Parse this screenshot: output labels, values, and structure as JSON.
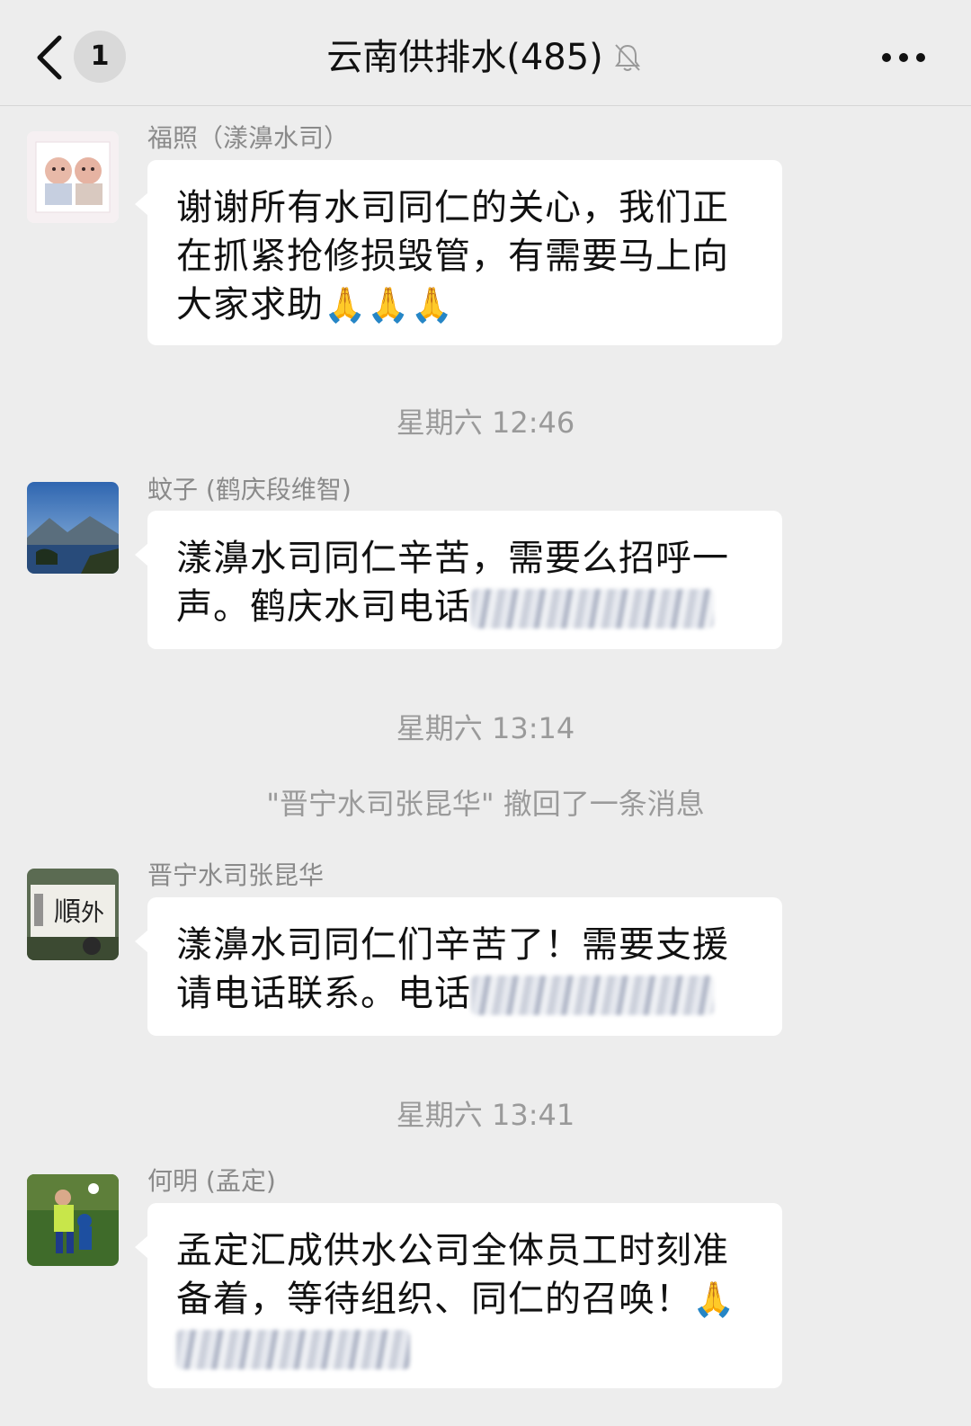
{
  "header": {
    "unread_count": "1",
    "title": "云南供排水(485)"
  },
  "messages": [
    {
      "sender": "福照（漾濞水司）",
      "text": "谢谢所有水司同仁的关心，我们正在抓紧抢修损毁管，有需要马上向大家求助",
      "emoji": "🙏🙏🙏"
    },
    {
      "timestamp": "星期六 12:46",
      "sender": "蚊子 (鹤庆段维智)",
      "text": "漾濞水司同仁辛苦，需要么招呼一声。鹤庆水司电话"
    },
    {
      "timestamp": "星期六 13:14",
      "system": "\"晋宁水司张昆华\" 撤回了一条消息",
      "sender": "晋宁水司张昆华",
      "text": "漾濞水司同仁们辛苦了！需要支援请电话联系。电话"
    },
    {
      "timestamp": "星期六 13:41",
      "sender": "何明 (孟定)",
      "text": "孟定汇成供水公司全体员工时刻准备着，等待组织、同仁的召唤！",
      "emoji": "🙏"
    }
  ],
  "colors": {
    "background": "#ededed",
    "bubble": "#ffffff",
    "meta_text": "#9a9a9a"
  },
  "icons": [
    "back-arrow-icon",
    "bell-mute-icon",
    "more-icon"
  ]
}
